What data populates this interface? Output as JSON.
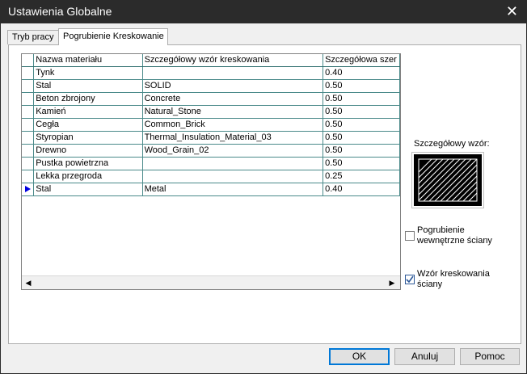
{
  "window": {
    "title": "Ustawienia Globalne"
  },
  "tabs": [
    {
      "label": "Tryb pracy"
    },
    {
      "label": "Pogrubienie Kreskowanie"
    }
  ],
  "grid": {
    "columns": [
      "Nazwa materiału",
      "Szczegółowy wzór kreskowania",
      "Szczegółowa szer"
    ],
    "rows": [
      {
        "name": "Tynk",
        "pattern": "",
        "width": "0.40"
      },
      {
        "name": "Stal",
        "pattern": "SOLID",
        "width": "0.50"
      },
      {
        "name": "Beton zbrojony",
        "pattern": "Concrete",
        "width": "0.50"
      },
      {
        "name": "Kamień",
        "pattern": "Natural_Stone",
        "width": "0.50"
      },
      {
        "name": "Cegła",
        "pattern": "Common_Brick",
        "width": "0.50"
      },
      {
        "name": "Styropian",
        "pattern": "Thermal_Insulation_Material_03",
        "width": "0.50"
      },
      {
        "name": "Drewno",
        "pattern": "Wood_Grain_02",
        "width": "0.50"
      },
      {
        "name": "Pustka powietrzna",
        "pattern": "",
        "width": "0.50"
      },
      {
        "name": "Lekka przegroda",
        "pattern": "",
        "width": "0.25"
      },
      {
        "name": "Stal",
        "pattern": "Metal",
        "width": "0.40"
      }
    ]
  },
  "preview": {
    "label": "Szczegółowy wzór:"
  },
  "options": {
    "inner_wall_bold": {
      "label1": "Pogrubienie",
      "label2": "wewnętrzne ściany",
      "checked": false
    },
    "hatch_pattern_wall": {
      "label1": "Wzór kreskowania",
      "label2": "ściany",
      "checked": true
    }
  },
  "buttons": {
    "ok": "OK",
    "cancel": "Anuluj",
    "help": "Pomoc"
  }
}
